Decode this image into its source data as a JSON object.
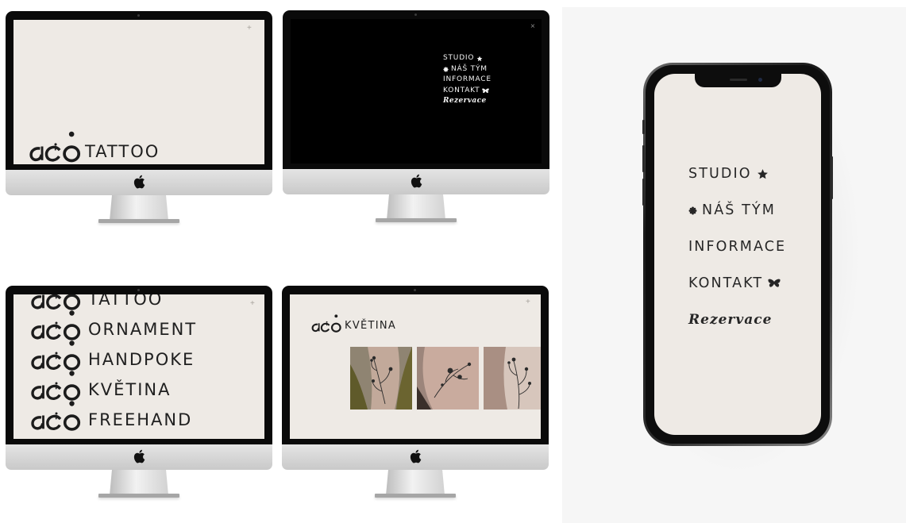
{
  "imac_home": {
    "brand_logo": "aćó",
    "brand_word": "TATTOO",
    "menu_toggle": "+"
  },
  "imac_menu": {
    "close_icon": "×",
    "items": [
      "STUDIO",
      "NÁŠ TÝM",
      "INFORMACE",
      "KONTAKT",
      "Rezervace"
    ]
  },
  "imac_styles": {
    "menu_toggle": "+",
    "items": [
      "TATTOO",
      "ORNAMENT",
      "HANDPOKE",
      "KVĚTINA",
      "FREEHAND"
    ]
  },
  "imac_gallery": {
    "menu_toggle": "+",
    "title": "KVĚTINA",
    "photos": [
      "tattoo-photo",
      "tattoo-photo",
      "tattoo-photo"
    ]
  },
  "phone_menu": {
    "items": [
      "STUDIO",
      "NÁŠ TÝM",
      "INFORMACE",
      "KONTAKT",
      "Rezervace"
    ]
  },
  "colors": {
    "screen_bg": "#eeeae5",
    "menu_bg": "#000000",
    "text": "#202020",
    "panel_bg": "#f6f6f6"
  },
  "icons": [
    "star-icon",
    "flower-icon",
    "butterfly-icon",
    "apple-logo-icon",
    "close-icon",
    "plus-icon"
  ]
}
